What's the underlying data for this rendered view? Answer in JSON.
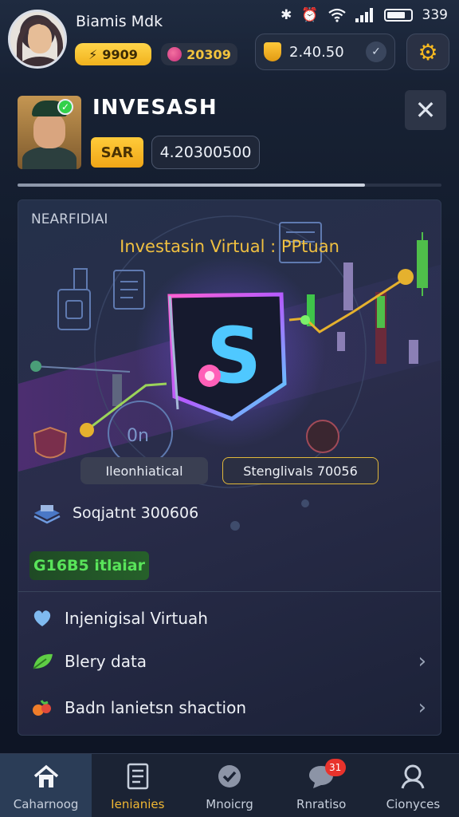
{
  "status_bar": {
    "time": "339",
    "icons": [
      "bluetooth-icon",
      "alarm-icon",
      "wifi-icon",
      "signal-icon",
      "battery-icon"
    ]
  },
  "header": {
    "username": "Biamis Mdk",
    "gold_pill": "9909",
    "gem_pill": "20309",
    "balance": "2.40.50",
    "settings_icon": "gear-icon"
  },
  "profile": {
    "title": "INVESASH",
    "currency_tag": "SAR",
    "amount": "4.20300500",
    "progress": 0.82
  },
  "card": {
    "label": "NEARFIDIAI",
    "hero_title": "Investasin Virtual : PPtuan",
    "tag_left": "Ileonhiatical",
    "tag_right": "Stenglivals 70056",
    "quest_text": "Soqjatnt 300606",
    "green_pill": "G16B5 itlaiar",
    "rows": [
      {
        "label": "Injenigisal Virtuah",
        "icon": "heart-icon",
        "chevron": false
      },
      {
        "label": "Blery data",
        "icon": "leaf-icon",
        "chevron": true
      },
      {
        "label": "Badn lanietsn shaction",
        "icon": "fruit-icon",
        "chevron": true
      }
    ]
  },
  "nav": [
    {
      "label": "Caharnoog",
      "icon": "home-icon",
      "active": true
    },
    {
      "label": "Ienianies",
      "icon": "document-icon",
      "active": false
    },
    {
      "label": "Mnoicrg",
      "icon": "check-circle-icon",
      "active": false
    },
    {
      "label": "Rnratiso",
      "icon": "chat-icon",
      "active": false,
      "badge": "31"
    },
    {
      "label": "Cionyces",
      "icon": "profile-icon",
      "active": false
    }
  ],
  "colors": {
    "accent_gold": "#f0b733",
    "accent_green": "#59e45a",
    "background": "#0d1424",
    "neon_pink": "#e04df5",
    "neon_cyan": "#4fe0ff"
  }
}
